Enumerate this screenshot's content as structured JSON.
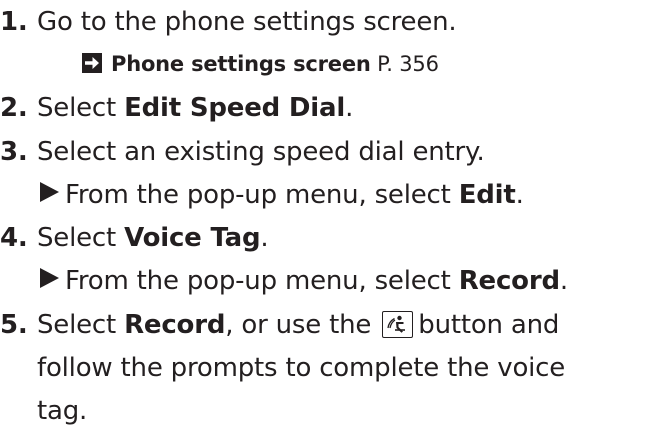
{
  "steps": [
    {
      "num": "1.",
      "text": "Go to the phone settings screen.",
      "reference": {
        "icon": "arrow-right-boxed-icon",
        "title": "Phone settings screen",
        "page": "P. 356"
      }
    },
    {
      "num": "2.",
      "prefix": "Select ",
      "bold": "Edit Speed Dial",
      "suffix": "."
    },
    {
      "num": "3.",
      "text": "Select an existing speed dial entry.",
      "substep": {
        "icon": "triangle-bullet-icon",
        "prefix": "From the pop-up menu, select ",
        "bold": "Edit",
        "suffix": "."
      }
    },
    {
      "num": "4.",
      "prefix": "Select ",
      "bold": "Voice Tag",
      "suffix": ".",
      "substep": {
        "icon": "triangle-bullet-icon",
        "prefix": "From the pop-up menu, select ",
        "bold": "Record",
        "suffix": "."
      }
    },
    {
      "num": "5.",
      "prefix": "Select ",
      "bold": "Record",
      "middle": ", or use the",
      "button_icon": "talk-button-icon",
      "suffix": "button and",
      "line2": "follow the prompts to complete the voice",
      "line3": "tag."
    }
  ]
}
